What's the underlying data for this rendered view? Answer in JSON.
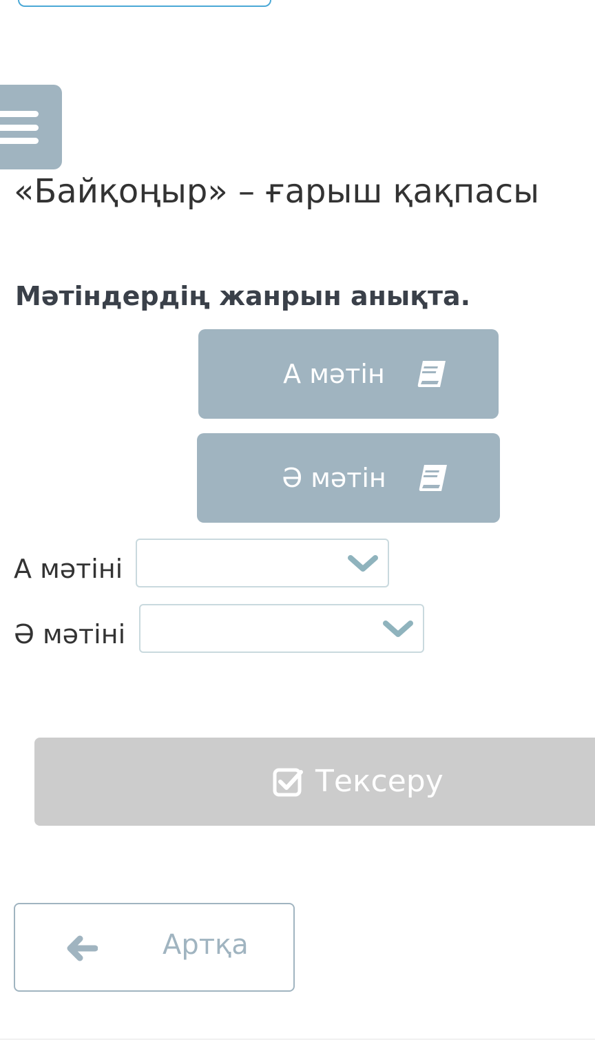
{
  "header": {
    "title": "«Байқоңыр» – ғарыш қақпасы"
  },
  "task": {
    "instruction": "Мәтіндердің жанрын анықта."
  },
  "text_buttons": [
    {
      "label": "А мәтін",
      "icon": "book-icon"
    },
    {
      "label": "Ә мәтін",
      "icon": "book-icon"
    }
  ],
  "answers": [
    {
      "label": "А мәтіні",
      "selected": ""
    },
    {
      "label": "Ә мәтіні",
      "selected": ""
    }
  ],
  "actions": {
    "check_label": "Тексеру",
    "back_label": "Артқа"
  },
  "colors": {
    "accent": "#a0b4c0",
    "disabled": "#cccccc",
    "chevron": "#8fb3bd",
    "input_border": "#c9d9de",
    "top_input_border": "#4aa8d6"
  }
}
